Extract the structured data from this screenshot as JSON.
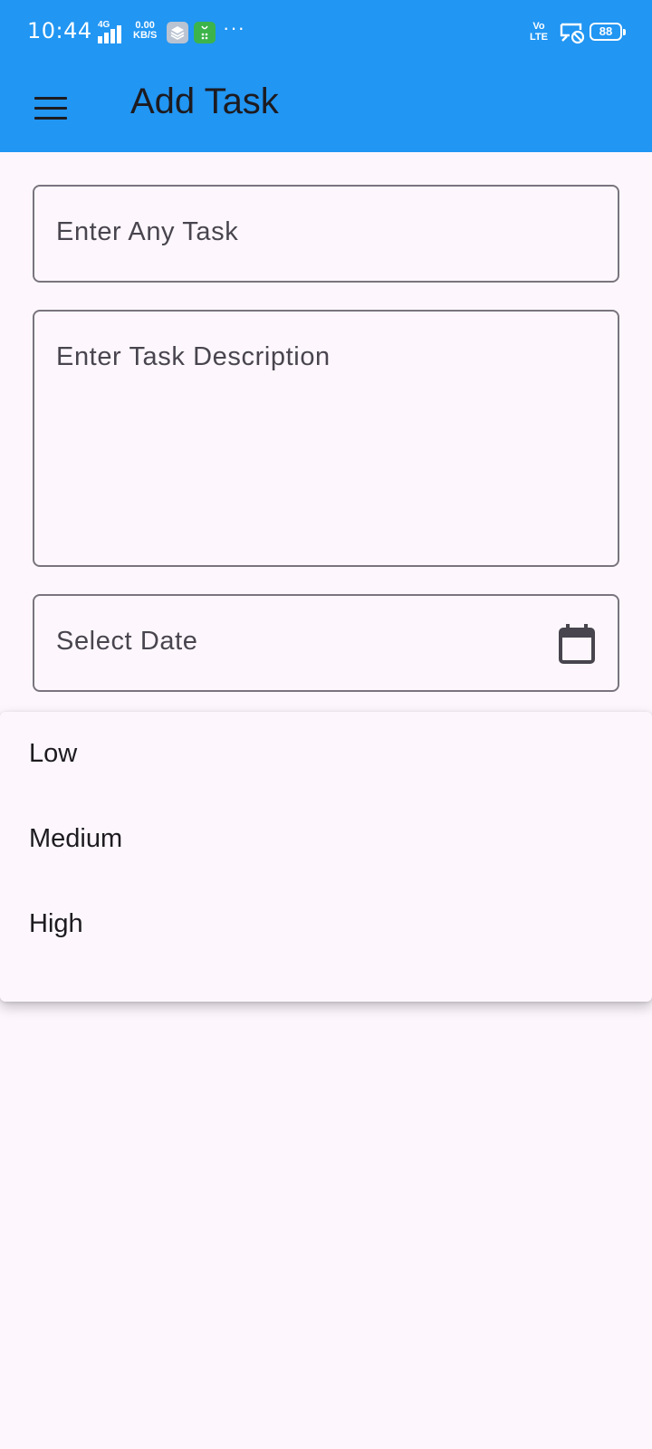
{
  "status_bar": {
    "time": "10:44",
    "network_type": "4G",
    "speed_value": "0.00",
    "speed_unit": "KB/S",
    "volte_top": "Vo",
    "volte_bottom": "LTE",
    "battery": "88",
    "more": "···"
  },
  "app_bar": {
    "title": "Add Task",
    "menu_icon": "menu-icon",
    "background_color": "#2196f3"
  },
  "form": {
    "task_placeholder": "Enter Any Task",
    "description_placeholder": "Enter Task Description",
    "date_placeholder": "Select Date",
    "date_icon": "calendar-icon"
  },
  "priority_dropdown": {
    "options": [
      "Low",
      "Medium",
      "High"
    ]
  }
}
